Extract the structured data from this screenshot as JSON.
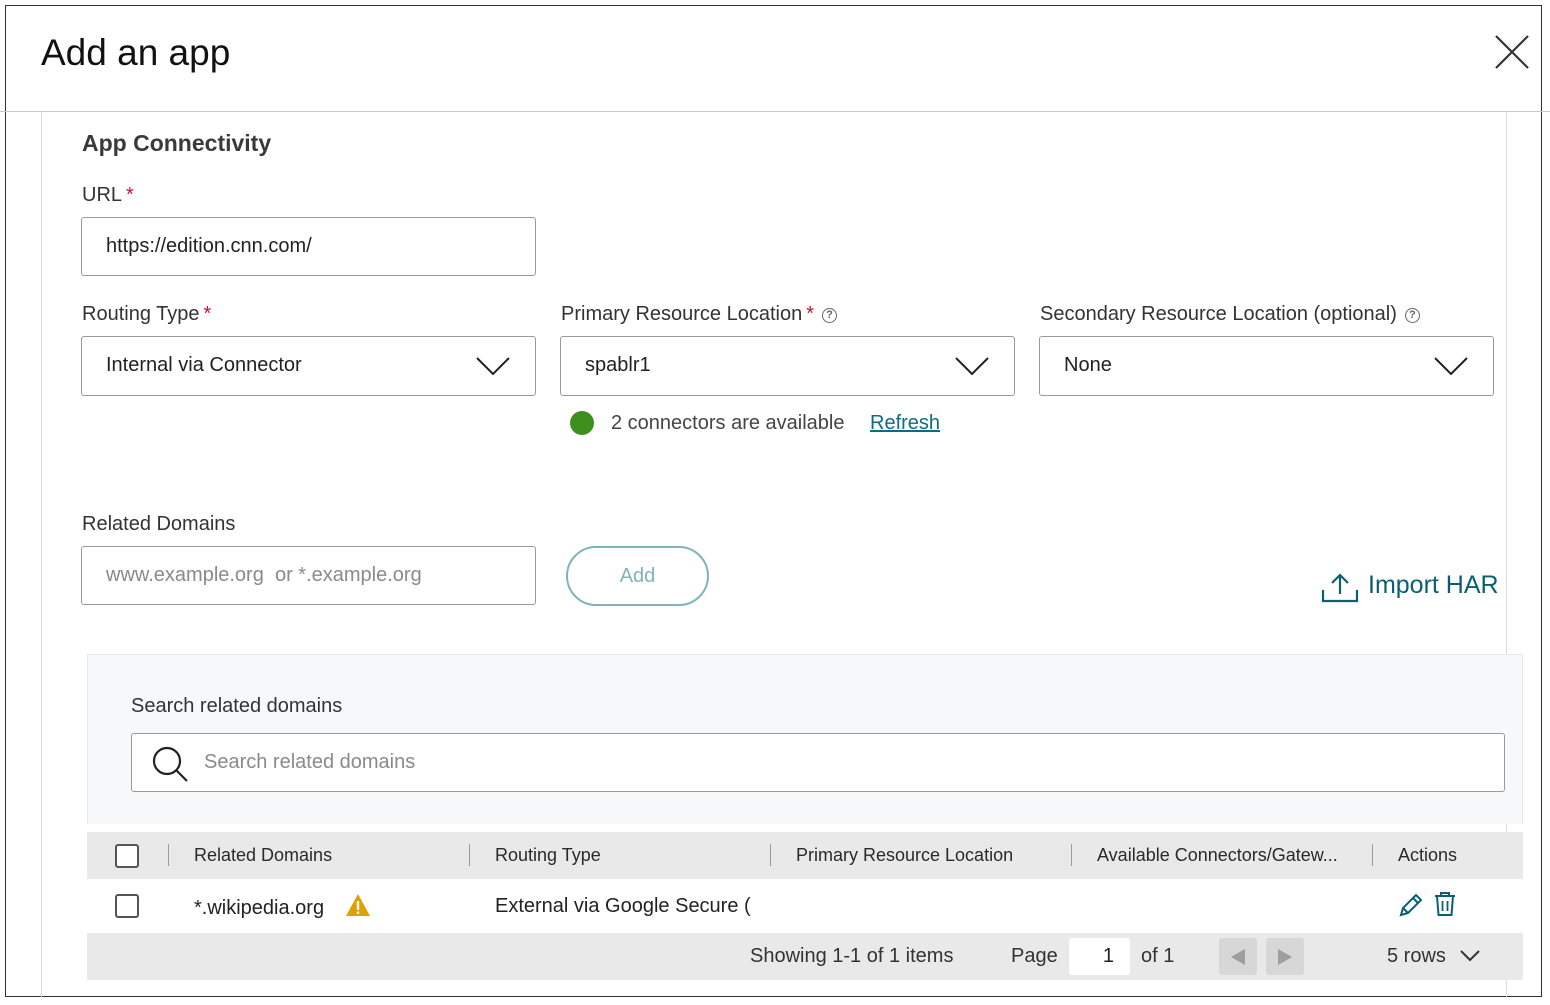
{
  "dialog": {
    "title": "Add an app",
    "close_icon": "close-icon"
  },
  "connectivity": {
    "section_title": "App Connectivity",
    "url_label": "URL",
    "url_value": "https://edition.cnn.com/",
    "required_mark": "*",
    "routing_type_label": "Routing Type",
    "routing_type_value": "Internal via Connector",
    "primary_location_label": "Primary Resource Location",
    "primary_location_value": "spablr1",
    "secondary_location_label": "Secondary Resource Location (optional)",
    "secondary_location_value": "None",
    "help_glyph": "?",
    "connector_status": "2 connectors are available",
    "status_color": "#3d8f1e",
    "refresh_label": "Refresh"
  },
  "related_domains": {
    "label": "Related Domains",
    "placeholder": "www.example.org  or *.example.org",
    "add_label": "Add",
    "import_label": "Import HAR",
    "search_label": "Search related domains",
    "search_placeholder": "Search related domains"
  },
  "table": {
    "columns": [
      "Related Domains",
      "Routing Type",
      "Primary Resource Location",
      "Available Connectors/Gatew...",
      "Actions"
    ],
    "rows": [
      {
        "domain": "*.wikipedia.org",
        "routing_type": "External via Google Secure (",
        "primary_location": "",
        "available": "",
        "warning_icon": "warning-icon",
        "warning_color": "#e0a100"
      }
    ]
  },
  "pagination": {
    "showing": "Showing 1-1 of 1 items",
    "page_label": "Page",
    "page_value": "1",
    "of_label": "of 1",
    "rows_label": "5 rows"
  },
  "colors": {
    "accent": "#0b5f72",
    "link": "#0b6c82",
    "required": "#c8102e"
  }
}
